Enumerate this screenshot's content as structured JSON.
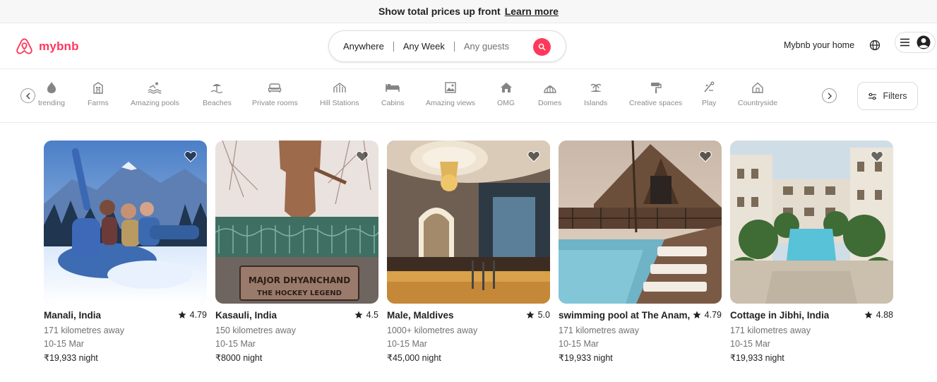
{
  "promo": {
    "text": "Show total prices up front",
    "link": "Learn more"
  },
  "header": {
    "brand": "mybnb",
    "search": {
      "where": "Anywhere",
      "when": "Any Week",
      "who": "Any guests"
    },
    "host_link": "Mybnb your home"
  },
  "categories": [
    {
      "label": "trending",
      "icon": "flame-icon"
    },
    {
      "label": "Farms",
      "icon": "barn-icon"
    },
    {
      "label": "Amazing pools",
      "icon": "pool-icon"
    },
    {
      "label": "Beaches",
      "icon": "beach-icon"
    },
    {
      "label": "Private rooms",
      "icon": "bed-icon"
    },
    {
      "label": "Hill Stations",
      "icon": "mountain-icon"
    },
    {
      "label": "Cabins",
      "icon": "cabin-icon"
    },
    {
      "label": "Amazing views",
      "icon": "picture-icon"
    },
    {
      "label": "OMG",
      "icon": "house-icon"
    },
    {
      "label": "Domes",
      "icon": "dome-icon"
    },
    {
      "label": "Islands",
      "icon": "island-icon"
    },
    {
      "label": "Creative spaces",
      "icon": "paint-roller-icon"
    },
    {
      "label": "Play",
      "icon": "play-icon"
    },
    {
      "label": "Countryside",
      "icon": "countryside-icon"
    }
  ],
  "filters_label": "Filters",
  "listings": [
    {
      "title": "Manali, India",
      "rating": "4.79",
      "distance": "171 kilometres away",
      "dates": "10-15 Mar",
      "price": "₹19,933 night"
    },
    {
      "title": "Kasauli, India",
      "rating": "4.5",
      "distance": "150 kilometres away",
      "dates": "10-15 Mar",
      "price": "₹8000 night",
      "photo_text": {
        "line1": "MAJOR DHYANCHAND",
        "line2": "THE HOCKEY LEGEND"
      }
    },
    {
      "title": "Male, Maldives",
      "rating": "5.0",
      "distance": "1000+ kilometres away",
      "dates": "10-15 Mar",
      "price": "₹45,000 night"
    },
    {
      "title": "swimming pool at The Anam,",
      "rating": "4.79",
      "distance": "171 kilometres away",
      "dates": "10-15 Mar",
      "price": "₹19,933 night"
    },
    {
      "title": "Cottage in Jibhi, India",
      "rating": "4.88",
      "distance": "171 kilometres away",
      "dates": "10-15 Mar",
      "price": "₹19,933 night"
    }
  ],
  "colors": {
    "accent": "#ff385c",
    "text": "#222222",
    "muted": "#717171",
    "border": "#dddddd"
  }
}
